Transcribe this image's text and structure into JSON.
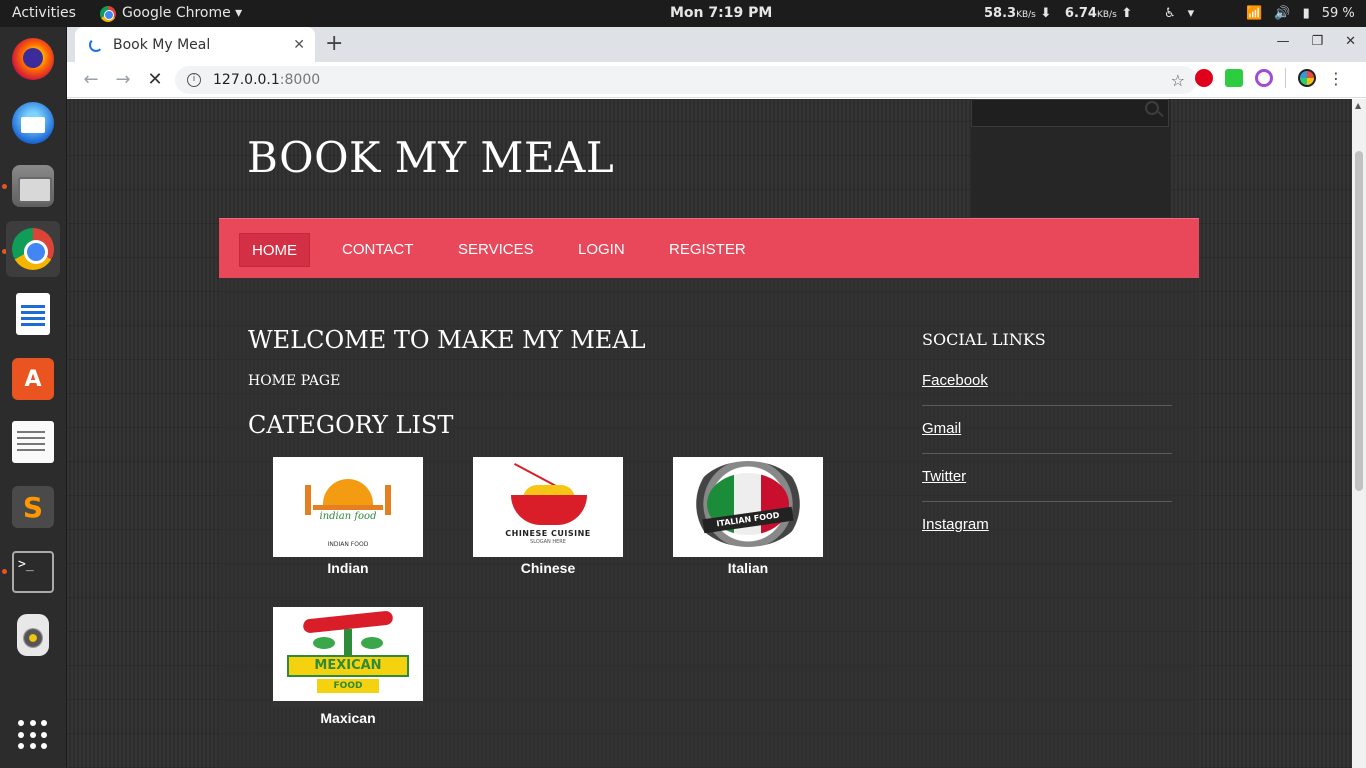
{
  "system_bar": {
    "activities": "Activities",
    "app_name": "Google Chrome ▾",
    "clock": "Mon  7:19 PM",
    "net_down": "58.3",
    "net_down_unit": "KB/s",
    "net_up": "6.74",
    "net_up_unit": "KB/s",
    "battery": "59 %"
  },
  "browser": {
    "tab_title": "Book My Meal",
    "tab_close": "✕",
    "new_tab": "+",
    "url_host": "127.0.0.1",
    "url_rest": ":8000"
  },
  "site": {
    "title": "BOOK MY MEAL",
    "nav": [
      "HOME",
      "CONTACT",
      "SERVICES",
      "LOGIN",
      "REGISTER"
    ],
    "active_nav": "HOME",
    "welcome": "WELCOME TO MAKE MY MEAL",
    "page_label": "HOME PAGE",
    "category_heading": "CATEGORY LIST",
    "categories": [
      {
        "name": "Indian",
        "image_text": "indian food",
        "image_sub": "INDIAN FOOD"
      },
      {
        "name": "Chinese",
        "image_text": "CHINESE CUISINE",
        "image_sub": "SLOGAN HERE"
      },
      {
        "name": "Italian",
        "image_text": "ITALIAN FOOD",
        "image_sub": ""
      },
      {
        "name": "Maxican",
        "image_text": "MEXICAN",
        "image_sub": "FOOD"
      }
    ],
    "social_heading": "SOCIAL LINKS",
    "social_links": [
      "Facebook",
      "Gmail",
      "Twitter",
      "Instagram"
    ]
  },
  "colors": {
    "nav_bar": "#e9475a",
    "nav_active": "#d43045",
    "page_bg": "#2f2f2f"
  }
}
